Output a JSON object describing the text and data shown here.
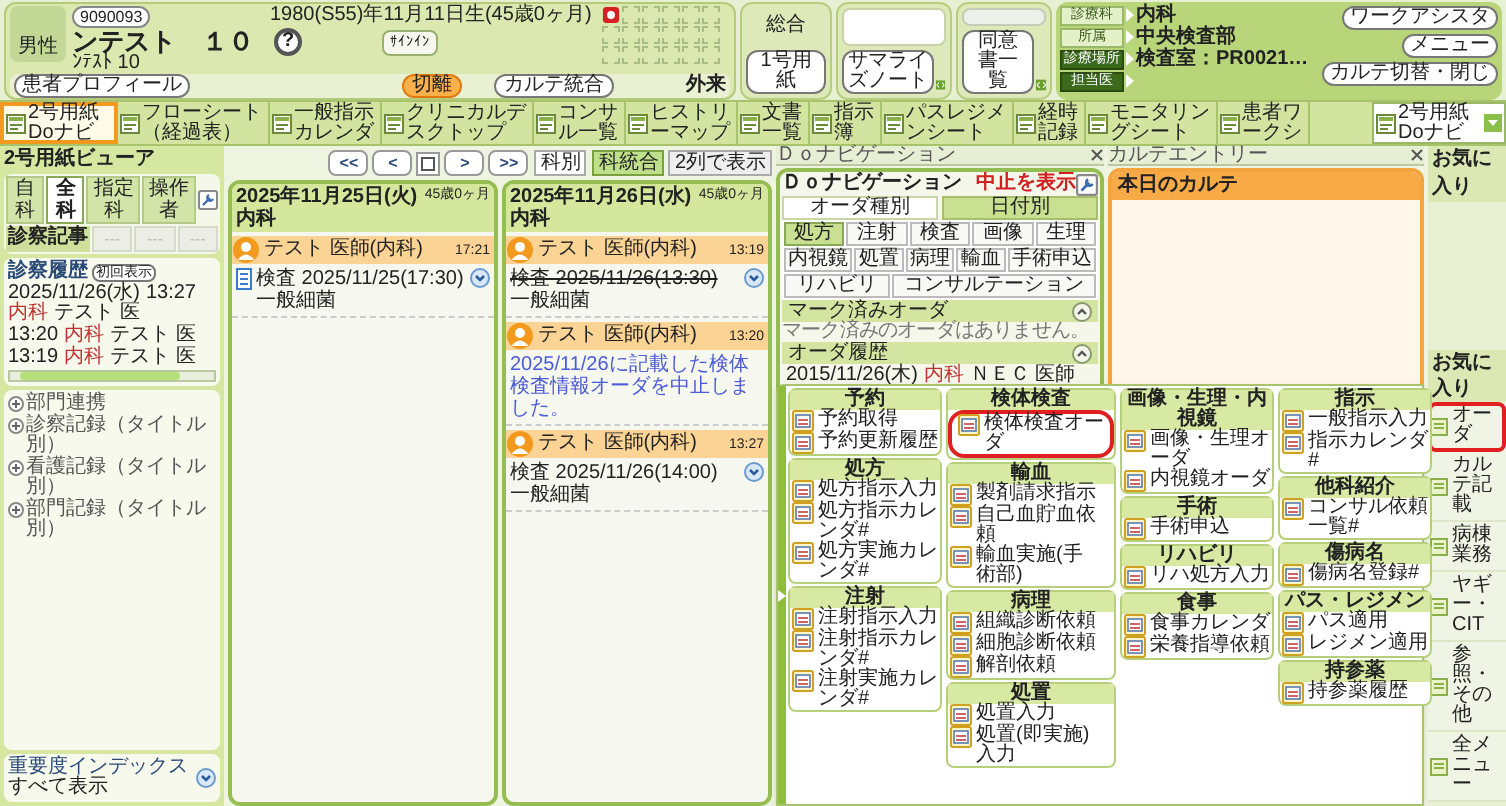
{
  "patient": {
    "id": "9090093",
    "name": "ンテスト　１０",
    "kana": "ﾝﾃｽﾄ 10",
    "sex": "男性",
    "help": "?",
    "birth": "1980(S55)年11月11日生(45歳0ヶ月)",
    "sign_button": "ｻｲﾝｲﾝ",
    "profile_button": "患者プロフィール",
    "actions": [
      {
        "label": "切離",
        "active": true
      },
      {
        "label": "カルテ統合",
        "active": false
      }
    ],
    "visit_type": "外来",
    "flag_slots": [
      {
        "kind": "alert"
      },
      {
        "kind": "empty"
      },
      {
        "kind": "empty"
      },
      {
        "kind": "empty"
      },
      {
        "kind": "empty"
      },
      {
        "kind": "empty"
      },
      {
        "kind": "empty"
      },
      {
        "kind": "empty"
      },
      {
        "kind": "empty"
      },
      {
        "kind": "empty"
      },
      {
        "kind": "empty"
      },
      {
        "kind": "empty"
      },
      {
        "kind": "empty"
      },
      {
        "kind": "empty"
      },
      {
        "kind": "empty"
      },
      {
        "kind": "empty"
      },
      {
        "kind": "empty"
      },
      {
        "kind": "empty"
      }
    ]
  },
  "notes": [
    {
      "kind": "label",
      "label": "総合",
      "button": "1号用紙"
    },
    {
      "kind": "text",
      "button": "サマライズノート"
    },
    {
      "kind": "grey",
      "button": "同意書一覧"
    }
  ],
  "info": [
    {
      "kind": "light",
      "label": "診療科",
      "value": "内科"
    },
    {
      "kind": "light",
      "label": "所属",
      "value": "中央検査部"
    },
    {
      "kind": "dark",
      "label": "診療場所",
      "value": "検査室：PR0021…"
    },
    {
      "kind": "dark",
      "label": "担当医"
    }
  ],
  "header_buttons": [
    "ワークアシスタ",
    "メニュー",
    "カルテ切替・閉じ"
  ],
  "toolbar": {
    "items": [
      {
        "label": "2号用紙Doナビ",
        "selected": true
      },
      {
        "label": "フローシート（経過表）",
        "selected": false
      },
      {
        "label": "一般指示カレンダ",
        "selected": false
      },
      {
        "label": "クリニカルデスクトップ",
        "selected": false
      },
      {
        "label": "コンサル一覧",
        "selected": false
      },
      {
        "label": "ヒストリーマップ",
        "selected": false
      },
      {
        "label": "文書一覧",
        "selected": false
      },
      {
        "label": "指示簿",
        "selected": false
      },
      {
        "label": "パスレジメンシート",
        "selected": false
      },
      {
        "label": "経時記録",
        "selected": false
      },
      {
        "label": "モニタリングシート",
        "selected": false
      },
      {
        "label": "患者ワークシ",
        "selected": false
      }
    ],
    "dropdown": "2号用紙Doナビ"
  },
  "viewer": {
    "title": "2号用紙ビューア",
    "tabs": [
      {
        "label": "自科",
        "selected": false
      },
      {
        "label": "全科",
        "selected": true
      },
      {
        "label": "指定科",
        "selected": false
      },
      {
        "label": "操作者",
        "selected": false
      }
    ],
    "record_label": "診察記事",
    "record_cells": [
      "---",
      "---",
      "---"
    ],
    "history": {
      "title": "診察履歴",
      "button": "初回表示",
      "rows": [
        {
          "date": "2025/11/26(水)",
          "time": "13:27",
          "dept": "内科",
          "name": "テスト 医"
        },
        {
          "time": "13:20",
          "dept": "内科",
          "name": "テスト 医"
        },
        {
          "time": "13:19",
          "dept": "内科",
          "name": "テスト 医"
        }
      ]
    },
    "tree": [
      {
        "label": "部門連携",
        "expanded": false
      },
      {
        "label": "診察記録（タイトル別）",
        "expanded": false
      },
      {
        "label": "看護記録（タイトル別）",
        "expanded": false
      },
      {
        "label": "部門記録（タイトル別）",
        "expanded": false
      }
    ],
    "index": {
      "title": "重要度インデックス",
      "value": "すべて表示"
    }
  },
  "nav": {
    "buttons": [
      {
        "kind": "text",
        "label": "<<"
      },
      {
        "kind": "text",
        "label": "<"
      },
      {
        "kind": "square"
      },
      {
        "kind": "text",
        "label": ">"
      },
      {
        "kind": "text",
        "label": ">>"
      }
    ],
    "modes": [
      {
        "label": "科別",
        "selected": false
      },
      {
        "label": "科統合",
        "selected": true
      }
    ],
    "columns_button": "2列で表示"
  },
  "days": [
    {
      "header": "2025年11月25日(火) 内科",
      "age": "45歳0ヶ月",
      "entries": [
        {
          "kind": "order",
          "author": "テスト 医師(内科)",
          "time": "17:21",
          "icon": true,
          "canceled": false,
          "lines": [
            "検査 2025/11/25(17:30)",
            "一般細菌"
          ]
        }
      ]
    },
    {
      "header": "2025年11月26日(水) 内科",
      "age": "45歳0ヶ月",
      "entries": [
        {
          "kind": "order",
          "author": "テスト 医師(内科)",
          "time": "13:19",
          "icon": false,
          "canceled": true,
          "lines": [
            "検査 2025/11/26(13:30)",
            "一般細菌"
          ]
        },
        {
          "kind": "note",
          "author": "テスト 医師(内科)",
          "time": "13:20",
          "text": "2025/11/26に記載した検体検査情報オーダを中止しました。"
        },
        {
          "kind": "order",
          "author": "テスト 医師(内科)",
          "time": "13:27",
          "icon": false,
          "canceled": false,
          "lines": [
            "検査 2025/11/26(14:00)",
            "一般細菌"
          ]
        }
      ]
    }
  ],
  "do_nav": {
    "panel_title": "Ｄｏナビゲーション",
    "title": "Ｄｏナビゲーション",
    "stop_button": "中止を表示",
    "tabs": [
      {
        "label": "オーダ種別",
        "selected": true
      },
      {
        "label": "日付別",
        "selected": false
      }
    ],
    "types": [
      {
        "label": "処方",
        "selected": true
      },
      {
        "label": "注射",
        "selected": false
      },
      {
        "label": "検査",
        "selected": false
      },
      {
        "label": "画像",
        "selected": false
      },
      {
        "label": "生理",
        "selected": false
      },
      {
        "label": "内視鏡",
        "selected": false
      },
      {
        "label": "処置",
        "selected": false
      },
      {
        "label": "病理",
        "selected": false
      },
      {
        "label": "輸血",
        "selected": false
      },
      {
        "label": "手術申込",
        "selected": false
      },
      {
        "label": "リハビリ",
        "selected": false
      },
      {
        "label": "コンサルテーション",
        "selected": false
      }
    ],
    "sections": [
      {
        "title": "マーク済みオーダ",
        "expanded": true,
        "kind": "message",
        "text": "マーク済みのオーダはありません。"
      },
      {
        "title": "オーダ履歴",
        "expanded": true,
        "kind": "history",
        "date": "2015/11/26(木)",
        "dept": "内科",
        "doctor": "ＮＥＣ 医師"
      }
    ]
  },
  "karte_entry": {
    "panel_title": "カルテエントリー",
    "title": "本日のカルテ"
  },
  "menu": {
    "columns": [
      [
        {
          "title": "予約",
          "items": [
            {
              "label": "予約取得",
              "highlighted": false
            },
            {
              "label": "予約更新履歴",
              "highlighted": false
            }
          ]
        },
        {
          "title": "処方",
          "items": [
            {
              "label": "処方指示入力",
              "highlighted": false
            },
            {
              "label": "処方指示カレンダ#",
              "highlighted": false
            },
            {
              "label": "処方実施カレンダ#",
              "highlighted": false
            }
          ]
        },
        {
          "title": "注射",
          "items": [
            {
              "label": "注射指示入力",
              "highlighted": false
            },
            {
              "label": "注射指示カレンダ#",
              "highlighted": false
            },
            {
              "label": "注射実施カレンダ#",
              "highlighted": false
            }
          ]
        }
      ],
      [
        {
          "title": "検体検査",
          "items": [
            {
              "label": "検体検査オーダ",
              "highlighted": true
            }
          ]
        },
        {
          "title": "輸血",
          "items": [
            {
              "label": "製剤請求指示",
              "highlighted": false
            },
            {
              "label": "自己血貯血依頼",
              "highlighted": false
            },
            {
              "label": "輸血実施(手術部)",
              "highlighted": false
            }
          ]
        },
        {
          "title": "病理",
          "items": [
            {
              "label": "組織診断依頼",
              "highlighted": false
            },
            {
              "label": "細胞診断依頼",
              "highlighted": false
            },
            {
              "label": "解剖依頼",
              "highlighted": false
            }
          ]
        },
        {
          "title": "処置",
          "items": [
            {
              "label": "処置入力",
              "highlighted": false
            },
            {
              "label": "処置(即実施)入力",
              "highlighted": false
            }
          ]
        }
      ],
      [
        {
          "title": "画像・生理・内視鏡",
          "items": [
            {
              "label": "画像・生理オーダ",
              "highlighted": false
            },
            {
              "label": "内視鏡オーダ",
              "highlighted": false
            }
          ]
        },
        {
          "title": "手術",
          "items": [
            {
              "label": "手術申込",
              "highlighted": false
            }
          ]
        },
        {
          "title": "リハビリ",
          "items": [
            {
              "label": "リハ処方入力",
              "highlighted": false
            }
          ]
        },
        {
          "title": "食事",
          "items": [
            {
              "label": "食事カレンダ",
              "highlighted": false
            },
            {
              "label": "栄養指導依頼",
              "highlighted": false
            }
          ]
        }
      ],
      [
        {
          "title": "指示",
          "items": [
            {
              "label": "一般指示入力",
              "highlighted": false
            },
            {
              "label": "指示カレンダ#",
              "highlighted": false
            }
          ]
        },
        {
          "title": "他科紹介",
          "items": [
            {
              "label": "コンサル依頼一覧#",
              "highlighted": false
            }
          ]
        },
        {
          "title": "傷病名",
          "items": [
            {
              "label": "傷病名登録#",
              "highlighted": false
            }
          ]
        },
        {
          "title": "パス・レジメン",
          "items": [
            {
              "label": "パス適用",
              "highlighted": false
            },
            {
              "label": "レジメン適用",
              "highlighted": false
            }
          ]
        },
        {
          "title": "持参薬",
          "items": [
            {
              "label": "持参薬履歴",
              "highlighted": false
            }
          ]
        }
      ]
    ]
  },
  "favorites_header": "お気に入り",
  "favorites": {
    "title": "お気に入り",
    "items": [
      {
        "label": "オーダ",
        "selected": true
      },
      {
        "label": "カルテ記載",
        "selected": false
      },
      {
        "label": "病棟業務",
        "selected": false
      },
      {
        "label": "ヤギー・CIT",
        "selected": false
      },
      {
        "label": "参照・その他",
        "selected": false
      },
      {
        "label": "全メニュー",
        "selected": false
      }
    ]
  }
}
